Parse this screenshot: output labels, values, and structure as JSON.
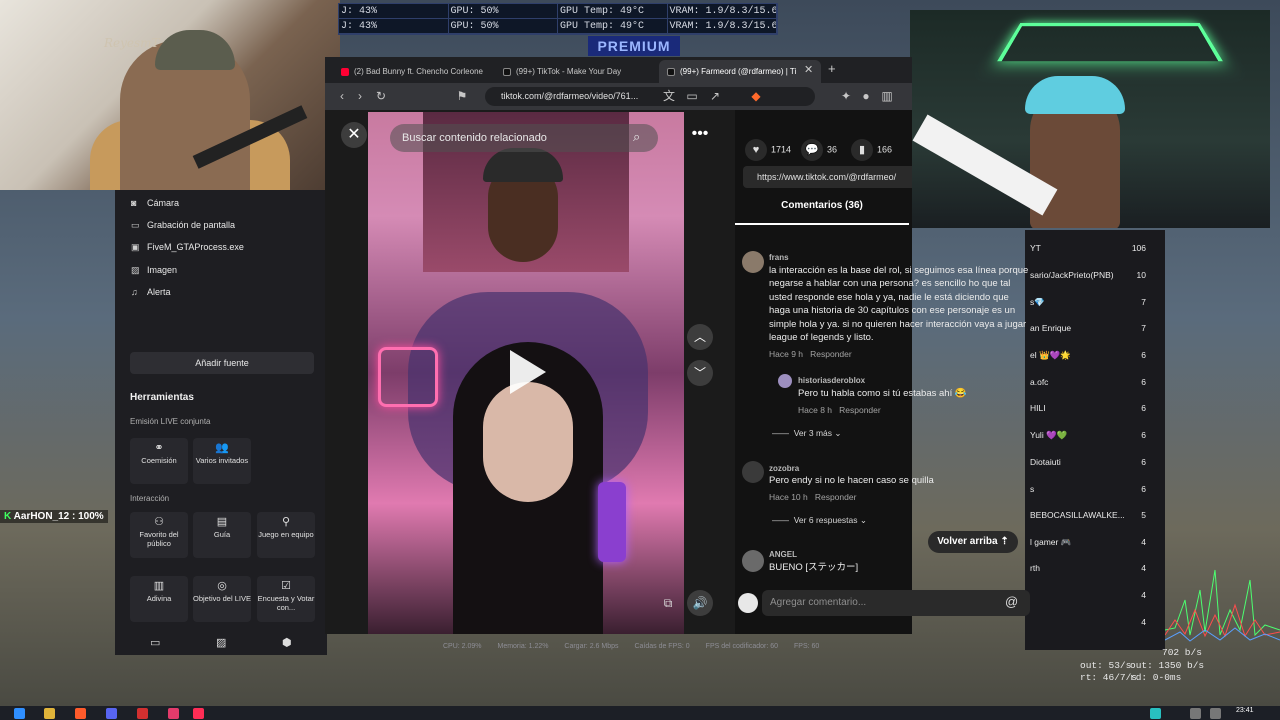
{
  "gpu_overlay": {
    "rows": [
      [
        "J: 43%",
        "GPU: 50%",
        "GPU Temp: 49°C",
        "VRAM: 1.9/8.3/15.6 GB"
      ],
      [
        "J: 43%",
        "GPU: 50%",
        "GPU Temp: 49°C",
        "VRAM: 1.9/8.3/15.6 GB"
      ]
    ]
  },
  "banner": "PREMIUM",
  "cam_left_watermark": "ReyesmT",
  "browser": {
    "tabs": [
      {
        "label": "(2) Bad Bunny ft. Chencho Corleone",
        "color": "#ff0033"
      },
      {
        "label": "(99+) TikTok - Make Your Day",
        "color": "#111111"
      },
      {
        "label": "(99+) Farmeord (@rdfarmeo) | Ti",
        "color": "#111111"
      }
    ],
    "url": "tiktok.com/@rdfarmeo/video/761..."
  },
  "video": {
    "search_placeholder": "Buscar contenido relacionado"
  },
  "stats": {
    "likes": "1714",
    "comments": "36",
    "saves": "166",
    "link": "https://www.tiktok.com/@rdfarmeo/"
  },
  "comments_tab": "Comentarios (36)",
  "comments": [
    {
      "user": "frans",
      "text": "la interacción es la base del rol, si seguimos esa línea porque negarse a hablar con una persona? es sencillo ho que tal usted responde ese hola y ya, nadie le está diciendo que haga una historia de 30 capítulos con ese personaje es un simple hola y ya. si no quieren hacer interacción vaya a jugar league of legends y listo.",
      "time": "Hace 9 h",
      "reply": "Responder"
    },
    {
      "user": "historiasderoblox",
      "text": "Pero tu habla como si tú estabas ahí 😂",
      "time": "Hace 8 h",
      "reply": "Responder"
    },
    {
      "user": "zozobra",
      "text": "Pero endy si no le hacen caso se quilla",
      "time": "Hace 10 h",
      "reply": "Responder"
    },
    {
      "user": "ANGEL",
      "text": "BUENO [ステッカー]"
    }
  ],
  "more_replies_1": "Ver 3 más",
  "more_replies_2": "Ver 6 respuestas",
  "back_to_top": "Volver arriba",
  "comment_placeholder": "Agregar comentario...",
  "obs": {
    "sources": [
      {
        "label": "Cámara",
        "icon": "camera-icon"
      },
      {
        "label": "Grabación de pantalla",
        "icon": "monitor-icon"
      },
      {
        "label": "FiveM_GTAProcess.exe",
        "icon": "window-icon"
      },
      {
        "label": "Imagen",
        "icon": "image-icon"
      },
      {
        "label": "Alerta",
        "icon": "bell-icon"
      }
    ],
    "add_source": "Añadir fuente",
    "tools_title": "Herramientas",
    "section_live": "Emisión LIVE conjunta",
    "live_tools": [
      "Coemisión",
      "Varios invitados"
    ],
    "section_interaction": "Interacción",
    "interaction_tools": [
      "Favorito del público",
      "Guía",
      "Juego en equipo",
      "Adivina",
      "Objetivo del LIVE",
      "Encuesta y Votar con..."
    ]
  },
  "ranking": [
    {
      "name": "YT",
      "count": "106"
    },
    {
      "name": "sario/JackPrieto(PNB)",
      "count": "10"
    },
    {
      "name": "s💎",
      "count": "7"
    },
    {
      "name": "an Enrique",
      "count": "7"
    },
    {
      "name": "el 👑💜🌟",
      "count": "6"
    },
    {
      "name": "a.ofc",
      "count": "6"
    },
    {
      "name": "HILI",
      "count": "6"
    },
    {
      "name": "Yuli 💜💚",
      "count": "6"
    },
    {
      "name": "Diotaiuti",
      "count": "6"
    },
    {
      "name": "s",
      "count": "6"
    },
    {
      "name": "BEBOCASILLAWALKE...",
      "count": "5"
    },
    {
      "name": "l gamer 🎮",
      "count": "4"
    },
    {
      "name": "rth",
      "count": "4"
    },
    {
      "name": "",
      "count": "4"
    },
    {
      "name": "",
      "count": "4"
    }
  ],
  "obs_status": [
    "CPU: 2.09%",
    "Memoria: 1.22%",
    "Cargar: 2.6 Mbps",
    "Caídas de FPS: 0",
    "FPS del codificador: 60",
    "FPS: 60"
  ],
  "net": [
    "702 b/s",
    "out: 53/s",
    "out: 1350 b/s",
    "rt: 46/7/s",
    "rd: 0-0ms"
  ],
  "overlay_player": "AarHON_12 : 100%",
  "clock": "23:41"
}
